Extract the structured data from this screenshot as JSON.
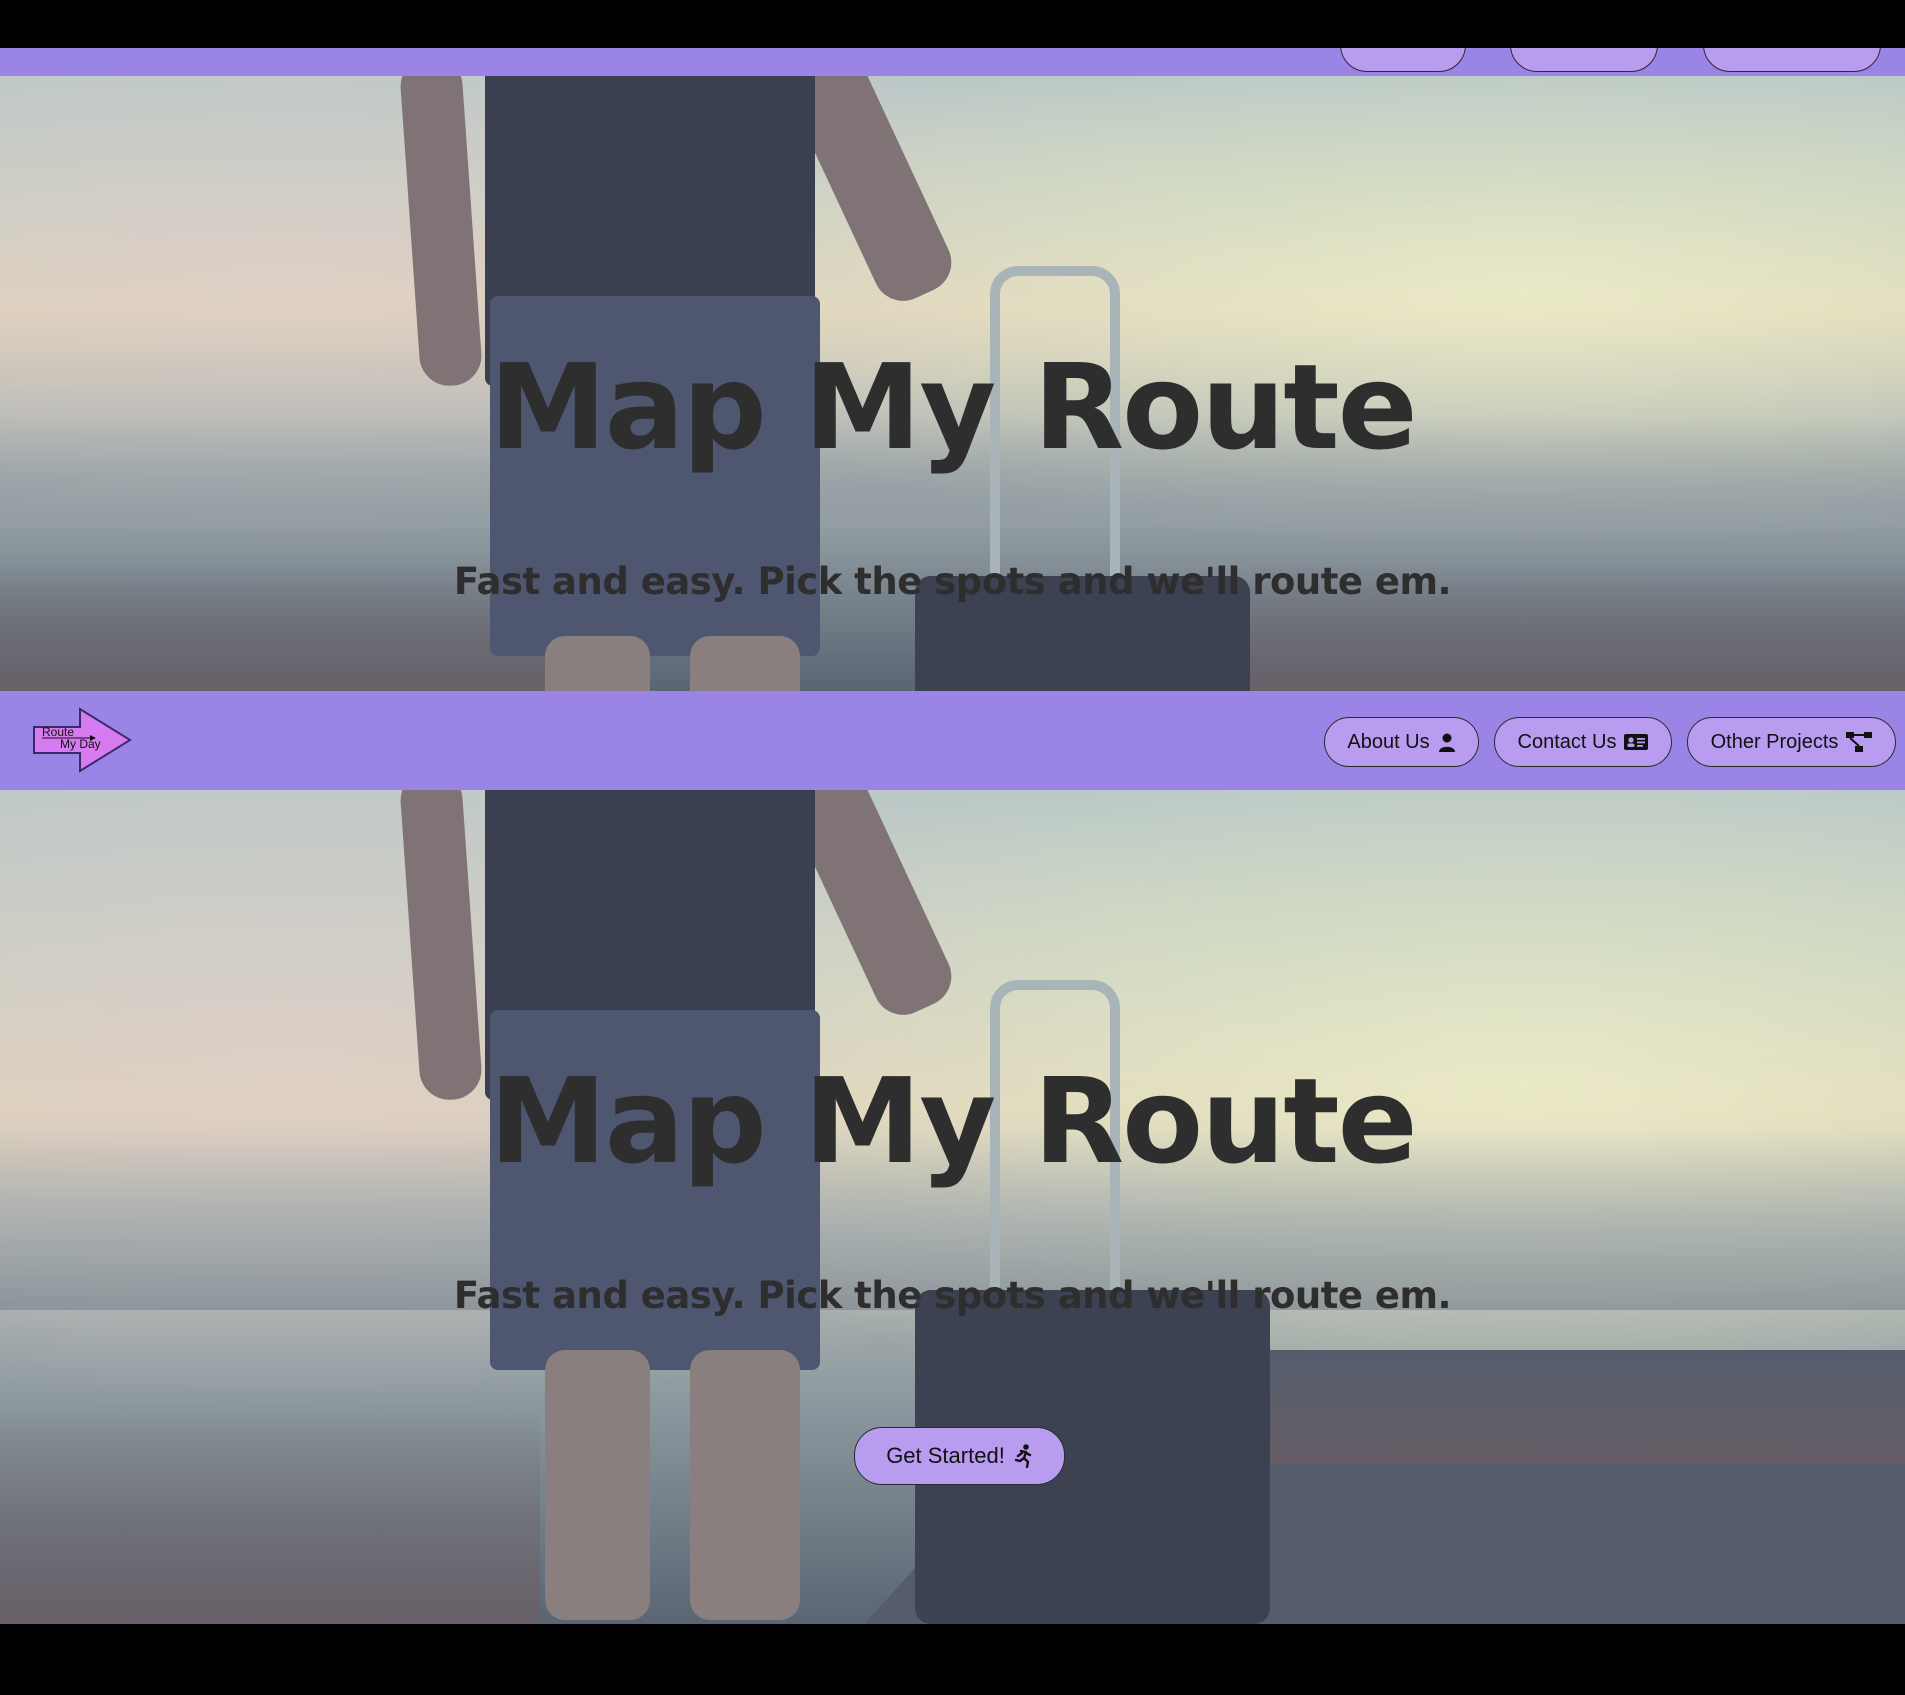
{
  "brand": {
    "logo_line1": "Route",
    "logo_line2": "My Day"
  },
  "nav": {
    "about_label": "About Us",
    "contact_label": "Contact Us",
    "projects_label": "Other Projects",
    "about_icon": "user-icon",
    "contact_icon": "id-card-icon",
    "projects_icon": "sitemap-icon"
  },
  "hero": {
    "title": "Map My Route",
    "subtitle": "Fast and easy. Pick the spots and we'll route em.",
    "cta_label": "Get Started!",
    "cta_icon": "running-person-icon"
  },
  "colors": {
    "nav_bg": "#9a85e6",
    "button_bg": "#b89cf0",
    "logo_fill": "#d77cf0",
    "text_dark": "#2e2e2e"
  }
}
